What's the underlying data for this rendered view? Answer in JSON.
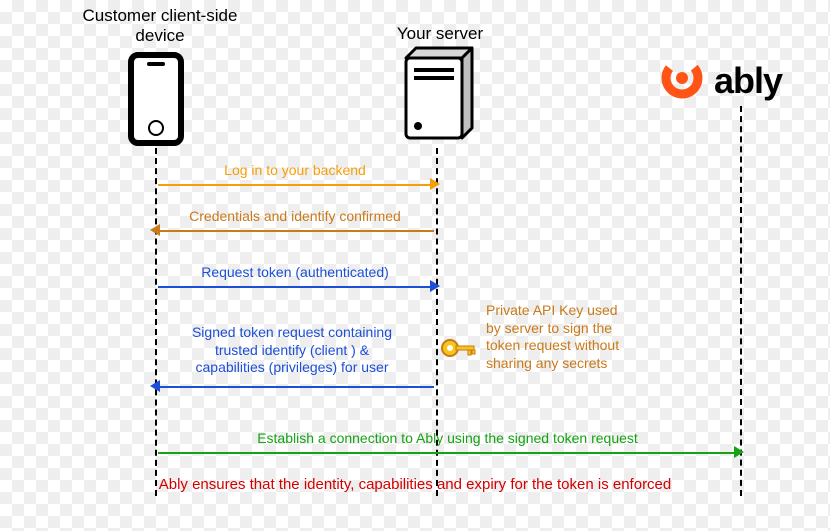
{
  "nodes": {
    "client": {
      "title": "Customer\nclient-side device"
    },
    "server": {
      "title": "Your server"
    },
    "ably": {
      "title": "ably"
    }
  },
  "messages": {
    "m1": {
      "text": "Log in to your backend",
      "color": "#f59e0b"
    },
    "m2": {
      "text": "Credentials and identify confirmed",
      "color": "#c97a1a"
    },
    "m3": {
      "text": "Request token (authenticated)",
      "color": "#1d4ed8"
    },
    "m4": {
      "text": "Signed token request containing\ntrusted identify (client ) &\ncapabilities (privileges) for user",
      "color": "#1d4ed8"
    },
    "m5": {
      "text": "Establish a connection to Ably using the signed token request",
      "color": "#15a315"
    }
  },
  "side_note": "Private API Key\nused by server to\nsign the token\nrequest without\nsharing any secrets",
  "footer": "Ably ensures that the identity, capabilities and expiry for the token is enforced",
  "icons": {
    "phone": "phone-icon",
    "server": "server-icon",
    "ably_logo": "ably-logo-icon",
    "key": "key-icon"
  },
  "colors": {
    "orange": "#f59e0b",
    "brown": "#c97a1a",
    "blue": "#1d4ed8",
    "green": "#15a315",
    "red": "#d30000",
    "ably_orange": "#ff5416"
  }
}
